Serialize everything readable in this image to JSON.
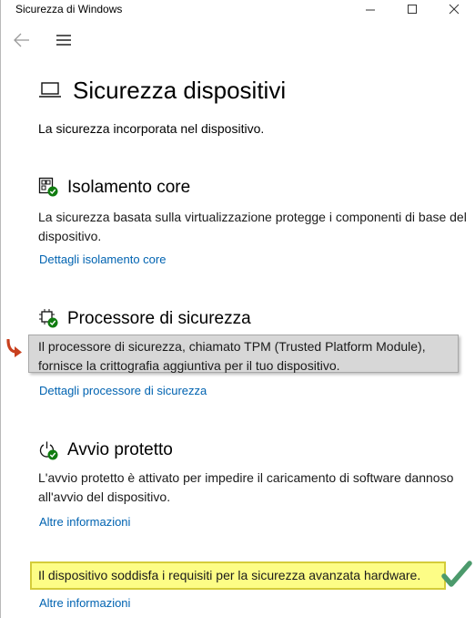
{
  "window": {
    "title": "Sicurezza di Windows"
  },
  "page": {
    "title": "Sicurezza dispositivi",
    "description": "La sicurezza incorporata nel dispositivo."
  },
  "sections": {
    "core_isolation": {
      "title": "Isolamento core",
      "text": "La sicurezza basata sulla virtualizzazione protegge i componenti di base del dispositivo.",
      "link": "Dettagli isolamento core"
    },
    "security_processor": {
      "title": "Processore di sicurezza",
      "text": "Il processore di sicurezza, chiamato TPM (Trusted Platform Module), fornisce la crittografia aggiuntiva per il tuo dispositivo.",
      "link": "Dettagli processore di sicurezza"
    },
    "secure_boot": {
      "title": "Avvio protetto",
      "text": "L'avvio protetto è attivato per impedire il caricamento di software dannoso all'avvio del dispositivo.",
      "link": "Altre informazioni"
    }
  },
  "hardware_status": {
    "text": "Il dispositivo soddisfa i requisiti per la sicurezza avanzata hardware.",
    "link": "Altre informazioni"
  },
  "colors": {
    "link": "#0063b1",
    "highlight_yellow": "#fdfd86",
    "status_green": "#107c10",
    "annotation_red": "#c8401e",
    "annotation_green": "#4c9a6c"
  }
}
